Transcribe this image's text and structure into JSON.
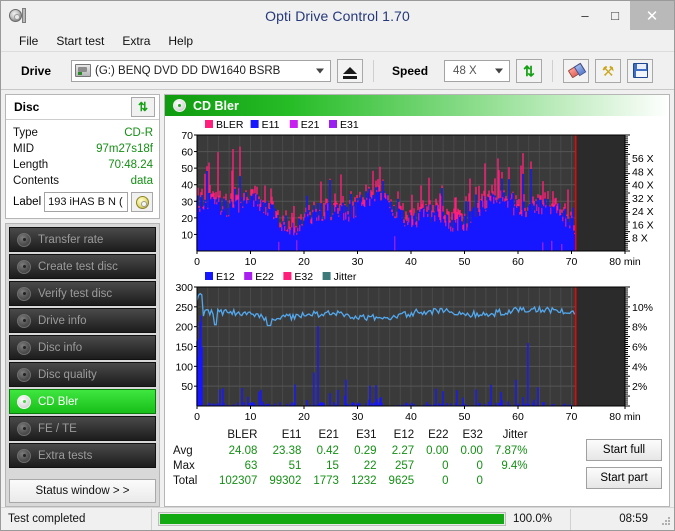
{
  "window": {
    "title": "Opti Drive Control 1.70",
    "icon": "disc-icon",
    "minimize": "–",
    "maximize": "☐",
    "close": "×"
  },
  "menu": {
    "items": [
      "File",
      "Start test",
      "Extra",
      "Help"
    ]
  },
  "toolbar": {
    "drive_label": "Drive",
    "drive_value": "(G:)   BENQ DVD DD DW1640 BSRB",
    "eject_icon": "eject-icon",
    "speed_label": "Speed",
    "speed_value": "48 X",
    "refresh_icon": "refresh-icon",
    "eraser_icon": "eraser-icon",
    "tools_icon": "tools-icon",
    "save_icon": "save-icon"
  },
  "disc": {
    "title": "Disc",
    "refresh_icon": "refresh-icon",
    "rows": [
      {
        "key": "Type",
        "value": "CD-R"
      },
      {
        "key": "MID",
        "value": "97m27s18f"
      },
      {
        "key": "Length",
        "value": "70:48.24"
      },
      {
        "key": "Contents",
        "value": "data"
      }
    ],
    "label_key": "Label",
    "label_value": "193 iHAS B N (",
    "label_button_icon": "cd-icon"
  },
  "nav": {
    "items": [
      {
        "label": "Transfer rate",
        "icon": "disc-icon",
        "active": false
      },
      {
        "label": "Create test disc",
        "icon": "disc-icon",
        "active": false
      },
      {
        "label": "Verify test disc",
        "icon": "disc-icon",
        "active": false
      },
      {
        "label": "Drive info",
        "icon": "disc-icon",
        "active": false
      },
      {
        "label": "Disc info",
        "icon": "disc-icon",
        "active": false
      },
      {
        "label": "Disc quality",
        "icon": "disc-icon",
        "active": false
      },
      {
        "label": "CD Bler",
        "icon": "disc-icon",
        "active": true
      },
      {
        "label": "FE / TE",
        "icon": "disc-icon",
        "active": false
      },
      {
        "label": "Extra tests",
        "icon": "disc-icon",
        "active": false
      }
    ],
    "status_window_label": "Status window > >"
  },
  "panel": {
    "title": "CD Bler",
    "icon": "disc-icon"
  },
  "chart_data": [
    {
      "type": "area",
      "title": "CD Bler error rates",
      "xlabel": "min",
      "ylabel": "",
      "xlim": [
        0,
        80
      ],
      "ylim": [
        0,
        70
      ],
      "xticks": [
        0,
        10,
        20,
        30,
        40,
        50,
        60,
        70,
        80
      ],
      "xticklabels": [
        "0",
        "10",
        "20",
        "30",
        "40",
        "50",
        "60",
        "70",
        "80 min"
      ],
      "yticks": [
        10,
        20,
        30,
        40,
        50,
        60,
        70
      ],
      "right_axis": {
        "label": "X",
        "ticks": [
          8,
          16,
          24,
          32,
          40,
          48,
          56
        ],
        "ticklabels": [
          "8 X",
          "16 X",
          "24 X",
          "32 X",
          "40 X",
          "48 X",
          "56 X"
        ],
        "lim": [
          0,
          70
        ]
      },
      "grid": true,
      "data_end_x": 70.8,
      "end_marker_color": "#ff0000",
      "legend": [
        {
          "name": "BLER",
          "color": "#ff1f7a"
        },
        {
          "name": "E11",
          "color": "#1717ff"
        },
        {
          "name": "E21",
          "color": "#c81ff0"
        },
        {
          "name": "E31",
          "color": "#9a1ff0"
        }
      ],
      "series": [
        {
          "name": "BLER",
          "color": "#ff1f7a",
          "avg": 24.08,
          "max": 63,
          "total": 102307
        },
        {
          "name": "E11",
          "color": "#1717ff",
          "avg": 23.38,
          "max": 51,
          "total": 99302
        },
        {
          "name": "E21",
          "color": "#c81ff0",
          "avg": 0.42,
          "max": 15,
          "total": 1773
        },
        {
          "name": "E31",
          "color": "#9a1ff0",
          "avg": 0.29,
          "max": 22,
          "total": 1232
        }
      ]
    },
    {
      "type": "line",
      "title": "CD Bler E12/E22/E32 and Jitter",
      "xlabel": "min",
      "ylabel": "",
      "xlim": [
        0,
        80
      ],
      "ylim": [
        0,
        300
      ],
      "xticks": [
        0,
        10,
        20,
        30,
        40,
        50,
        60,
        70,
        80
      ],
      "xticklabels": [
        "0",
        "10",
        "20",
        "30",
        "40",
        "50",
        "60",
        "70",
        "80 min"
      ],
      "yticks": [
        50,
        100,
        150,
        200,
        250,
        300
      ],
      "right_axis": {
        "label": "%",
        "ticks": [
          2,
          4,
          6,
          8,
          10
        ],
        "ticklabels": [
          "2%",
          "4%",
          "6%",
          "8%",
          "10%"
        ],
        "lim": [
          0,
          12
        ]
      },
      "grid": true,
      "data_end_x": 70.8,
      "end_marker_color": "#ff0000",
      "legend": [
        {
          "name": "E12",
          "color": "#1717ff"
        },
        {
          "name": "E22",
          "color": "#a81ff0"
        },
        {
          "name": "E32",
          "color": "#ff1f7a"
        },
        {
          "name": "Jitter",
          "color": "#3f7a7a"
        }
      ],
      "series": [
        {
          "name": "E12",
          "color": "#1717ff",
          "avg": 2.27,
          "max": 257,
          "total": 9625
        },
        {
          "name": "E22",
          "color": "#a81ff0",
          "avg": 0.0,
          "max": 0,
          "total": 0
        },
        {
          "name": "E32",
          "color": "#ff1f7a",
          "avg": 0.0,
          "max": 0,
          "total": 0
        },
        {
          "name": "Jitter",
          "color": "#53a8ee",
          "avg": "7.87%",
          "max": "9.4%",
          "total": ""
        }
      ]
    }
  ],
  "stats": {
    "columns": [
      "BLER",
      "E11",
      "E21",
      "E31",
      "E12",
      "E22",
      "E32",
      "Jitter"
    ],
    "rows": [
      {
        "label": "Avg",
        "values": [
          "24.08",
          "23.38",
          "0.42",
          "0.29",
          "2.27",
          "0.00",
          "0.00",
          "7.87%"
        ]
      },
      {
        "label": "Max",
        "values": [
          "63",
          "51",
          "15",
          "22",
          "257",
          "0",
          "0",
          "9.4%"
        ]
      },
      {
        "label": "Total",
        "values": [
          "102307",
          "99302",
          "1773",
          "1232",
          "9625",
          "0",
          "0",
          ""
        ]
      }
    ]
  },
  "actions": {
    "start_full": "Start full",
    "start_part": "Start part"
  },
  "statusbar": {
    "message": "Test completed",
    "progress_percent": 100,
    "progress_text": "100.0%",
    "elapsed": "08:59",
    "progress_color": "#13a913"
  }
}
